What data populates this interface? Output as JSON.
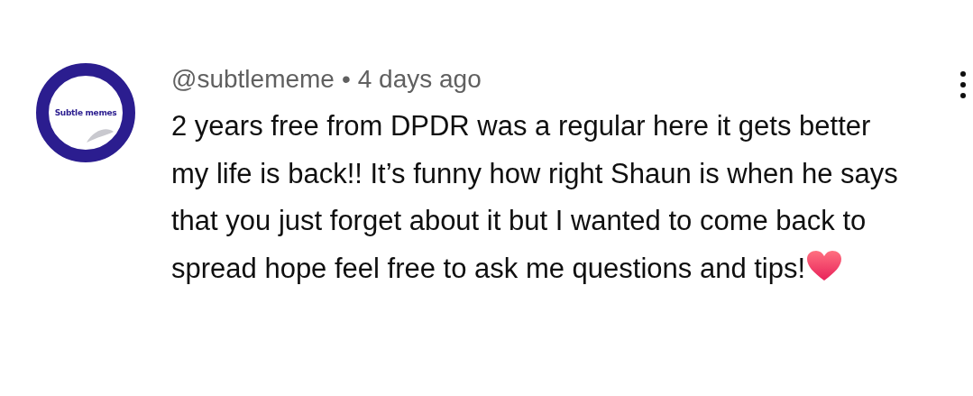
{
  "comment": {
    "avatar_text": "Subtle memes",
    "author": "@subtlememe",
    "separator": "•",
    "time": "4 days ago",
    "text": "2 years free from DPDR was a regular here it gets better my life is back!! It’s funny how right Shaun is when he says that you just forget about it but I wanted to come back to spread hope feel free to ask me questions and tips!"
  }
}
